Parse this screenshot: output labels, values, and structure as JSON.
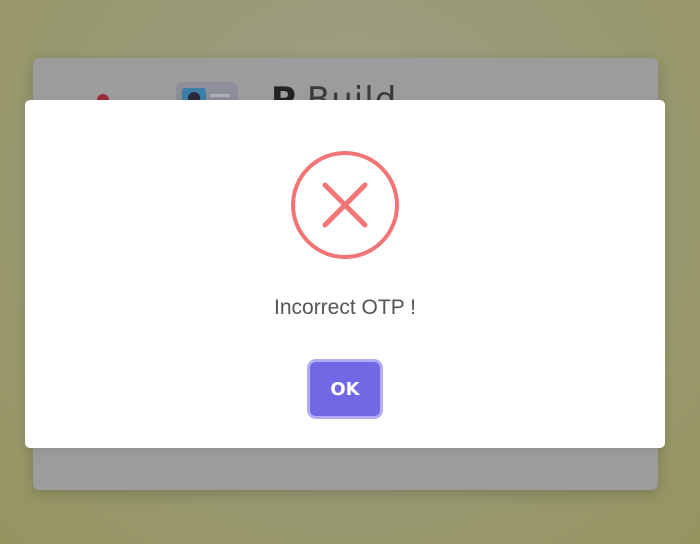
{
  "background": {
    "title_bold": "P",
    "title_light": "Build"
  },
  "dialog": {
    "icon": "error-x-icon",
    "message": "Incorrect OTP !",
    "ok_label": "OK"
  },
  "colors": {
    "error_red": "#f27474",
    "button_bg": "#7267e5",
    "button_focus_ring": "#b2acf4",
    "message_text": "#545454"
  }
}
